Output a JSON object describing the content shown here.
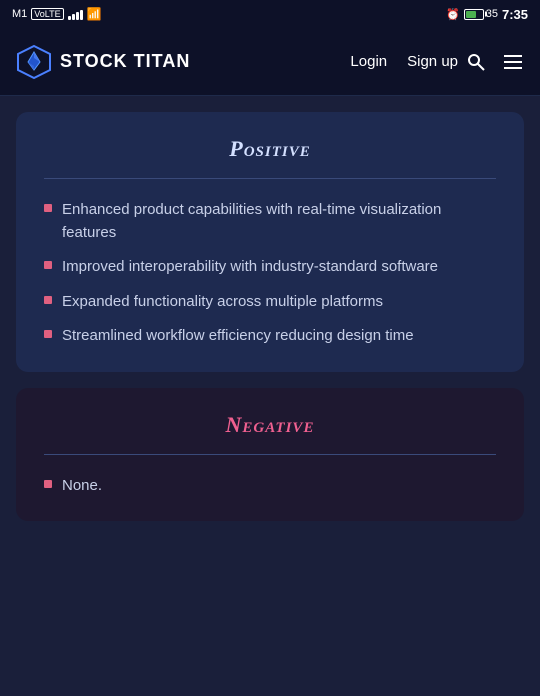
{
  "statusBar": {
    "carrier": "M1",
    "carrierBadge": "VoLTE",
    "time": "7:35",
    "batteryPercent": "35"
  },
  "navbar": {
    "logoText": "STOCK TITAN",
    "loginLabel": "Login",
    "signupLabel": "Sign up"
  },
  "positive": {
    "title": "Positive",
    "items": [
      "Enhanced product capabilities with real-time visualization features",
      "Improved interoperability with industry-standard software",
      "Expanded functionality across multiple platforms",
      "Streamlined workflow efficiency reducing design time"
    ]
  },
  "negative": {
    "title": "Negative",
    "items": [
      "None."
    ]
  }
}
